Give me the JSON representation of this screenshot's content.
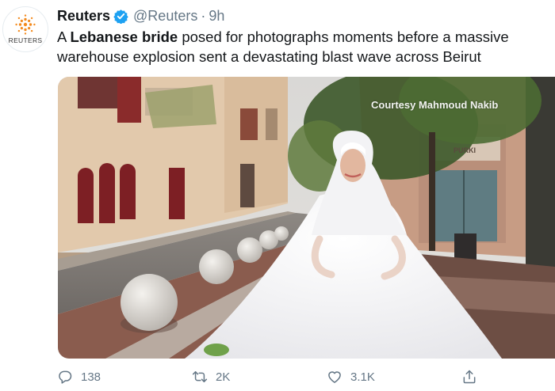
{
  "tweet": {
    "avatar_label": "REUTERS",
    "name": "Reuters",
    "handle": "@Reuters",
    "separator": "·",
    "time": "9h",
    "text_part1": "A ",
    "text_bold": "Lebanese bride",
    "text_part2": " posed for photographs moments before a massive",
    "text_line2": "warehouse explosion sent a devastating blast wave across Beirut"
  },
  "media": {
    "watermark": "Courtesy Mahmoud Nakib",
    "sign_text": "PURKI"
  },
  "actions": {
    "reply_count": "138",
    "retweet_count": "2K",
    "like_count": "3.1K"
  },
  "colors": {
    "accent": "#1da1f2",
    "muted": "#657786",
    "reuters_orange": "#f38b1f"
  }
}
